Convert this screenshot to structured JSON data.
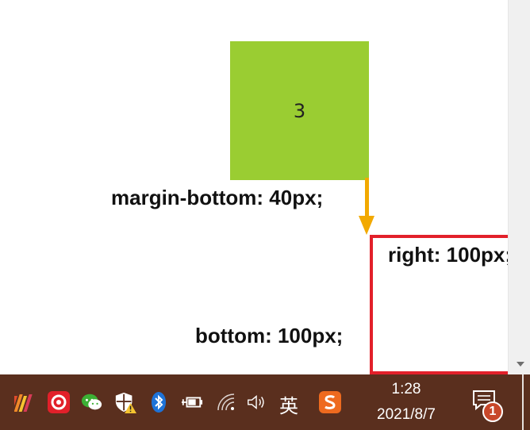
{
  "demo": {
    "box_number": "3",
    "margin_label": "margin-bottom: 40px;",
    "bottom_label": "bottom: 100px;",
    "right_label": "right: 100px;"
  },
  "taskbar": {
    "ime_label": "英",
    "clock_time": "1:28",
    "clock_date": "2021/8/7",
    "notification_count": "1",
    "icons": [
      "pycharm-icon",
      "netease-music-icon",
      "wechat-icon",
      "security-warning-icon",
      "bluetooth-icon",
      "power-icon",
      "wifi-icon",
      "volume-icon",
      "sogou-ime-icon",
      "action-center-icon"
    ]
  },
  "colors": {
    "green_box": "#9acd32",
    "arrow": "#f2a900",
    "highlight_border": "#e2202a",
    "taskbar": "#5a2f1e"
  }
}
